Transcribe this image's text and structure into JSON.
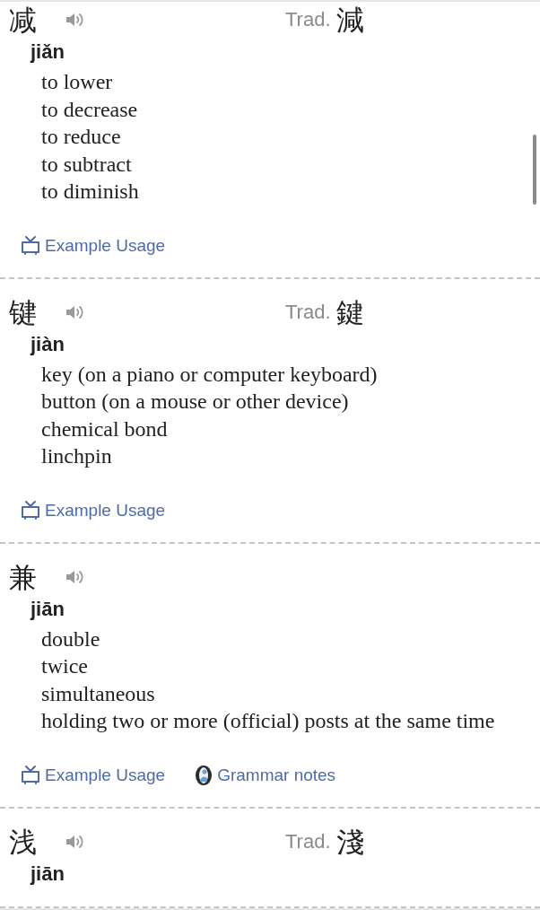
{
  "entries": [
    {
      "character": "减",
      "pinyin": "jiǎn",
      "traditional": {
        "label": "Trad.",
        "character": "減"
      },
      "definitions": [
        "to lower",
        "to decrease",
        "to reduce",
        "to subtract",
        "to diminish"
      ],
      "links": [
        {
          "kind": "example",
          "label": "Example Usage"
        }
      ]
    },
    {
      "character": "键",
      "pinyin": "jiàn",
      "traditional": {
        "label": "Trad.",
        "character": "鍵"
      },
      "definitions": [
        "key (on a piano or computer keyboard)",
        "button (on a mouse or other device)",
        "chemical bond",
        "linchpin"
      ],
      "links": [
        {
          "kind": "example",
          "label": "Example Usage"
        }
      ]
    },
    {
      "character": "兼",
      "pinyin": "jiān",
      "definitions": [
        "double",
        "twice",
        "simultaneous",
        "holding two or more (official) posts at the same time"
      ],
      "links": [
        {
          "kind": "example",
          "label": "Example Usage"
        },
        {
          "kind": "grammar",
          "label": "Grammar notes"
        }
      ]
    },
    {
      "character": "浅",
      "pinyin": "jiān",
      "traditional": {
        "label": "Trad.",
        "character": "淺"
      }
    }
  ]
}
